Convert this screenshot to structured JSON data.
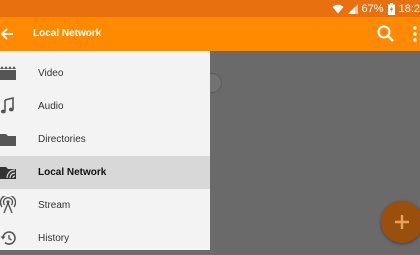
{
  "status_bar": {
    "battery_text": "67%",
    "time": "18:2"
  },
  "toolbar": {
    "title": "Local Network"
  },
  "drawer": {
    "items": [
      {
        "label": "Video",
        "icon": "video-icon",
        "active": false
      },
      {
        "label": "Audio",
        "icon": "music-note-icon",
        "active": false
      },
      {
        "label": "Directories",
        "icon": "folder-icon",
        "active": false
      },
      {
        "label": "Local Network",
        "icon": "network-folder-icon",
        "active": true
      },
      {
        "label": "Stream",
        "icon": "stream-antenna-icon",
        "active": false
      },
      {
        "label": "History",
        "icon": "history-icon",
        "active": false
      }
    ]
  },
  "colors": {
    "status_bar": "#e8700e",
    "toolbar": "#ff8a00",
    "drawer_bg": "#f3f3f3",
    "active_item_bg": "#d8d8d8",
    "scrim": "#6a6a6a",
    "fab": "#9a4f0c"
  }
}
